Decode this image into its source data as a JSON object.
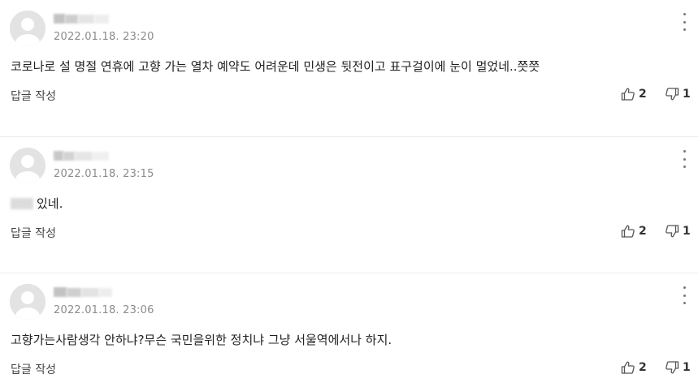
{
  "comments": [
    {
      "timestamp": "2022.01.18. 23:20",
      "text_masked": "",
      "text": "코로나로 설 명절 연휴에 고향 가는 열차 예약도 어려운데 민생은 뒷전이고 표구걸이에 눈이 멀었네..쯧쯧",
      "reply_label": "답글 작성",
      "likes": "2",
      "dislikes": "1"
    },
    {
      "timestamp": "2022.01.18. 23:15",
      "text_masked": "■",
      "text": "있네.",
      "reply_label": "답글 작성",
      "likes": "2",
      "dislikes": "1"
    },
    {
      "timestamp": "2022.01.18. 23:06",
      "text_masked": "",
      "text": "고향가는사람생각 안하냐?무슨 국민을위한 정치냐 그냥 서울역에서나 하지.",
      "reply_label": "답글 작성",
      "likes": "2",
      "dislikes": "1"
    }
  ],
  "icons": {
    "avatar": "default-avatar-icon",
    "more": "more-vertical-icon",
    "like": "thumbs-up-icon",
    "dislike": "thumbs-down-icon"
  },
  "colors": {
    "timestamp": "#8b8b8b",
    "divider": "#ebebeb",
    "avatar_bg": "#e3e3e3"
  }
}
